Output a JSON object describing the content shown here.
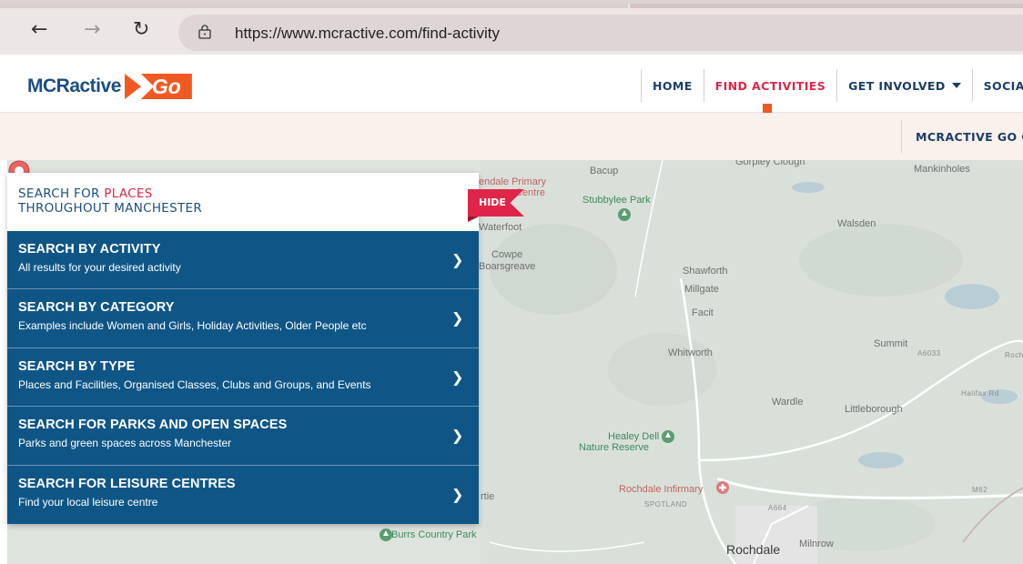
{
  "browser": {
    "back_icon": "back-arrow-icon",
    "forward_icon": "forward-arrow-icon",
    "reload_icon": "reload-icon",
    "url": "https://www.mcractive.com/find-activity"
  },
  "header": {
    "logo_text": "MCRactive",
    "logo_go": "Go",
    "nav": [
      {
        "label": "HOME",
        "active": false
      },
      {
        "label": "FIND ACTIVITIES",
        "active": true
      },
      {
        "label": "GET INVOLVED",
        "active": false,
        "dropdown": true
      },
      {
        "label": "SOCIAL",
        "active": false
      }
    ],
    "sub_nav_label": "MCRACTIVE GO C"
  },
  "panel": {
    "title_part1": "SEARCH FOR ",
    "title_highlight": "PLACES",
    "title_line2": "THROUGHOUT MANCHESTER",
    "hide_label": "HIDE",
    "rows": [
      {
        "title": "SEARCH BY ACTIVITY",
        "desc": "All results for your desired activity"
      },
      {
        "title": "SEARCH BY CATEGORY",
        "desc": "Examples include Women and Girls, Holiday Activities, Older People etc"
      },
      {
        "title": "SEARCH BY TYPE",
        "desc": "Places and Facilities, Organised Classes, Clubs and Groups, and Events"
      },
      {
        "title": "SEARCH FOR PARKS AND OPEN SPACES",
        "desc": "Parks and green spaces across Manchester"
      },
      {
        "title": "SEARCH FOR LEISURE CENTRES",
        "desc": "Find your local leisure centre"
      }
    ]
  },
  "map": {
    "labels": {
      "bacup": "Bacup",
      "stubbylee": "Stubbylee Park",
      "primary1": "endale Primary",
      "primary2": "Centre",
      "waterfoot": "Waterfoot",
      "cowpe": "Cowpe",
      "boarsgreave": "Boarsgreave",
      "mankinholes": "Mankinholes",
      "gorpley": "Gorpley Clough",
      "walsden": "Walsden",
      "shawforth": "Shawforth",
      "millgate": "Millgate",
      "facit": "Facit",
      "whitworth": "Whitworth",
      "summit": "Summit",
      "wardle": "Wardle",
      "littleborough": "Littleborough",
      "healey1": "Healey Dell",
      "healey2": "Nature Reserve",
      "infirmary": "Rochdale Infirmary",
      "spotland": "SPOTLAND",
      "rochdale": "Rochdale",
      "milnrow": "Milnrow",
      "burrs": "Burrs Country Park",
      "rtie": "rtie",
      "a6033": "A6033",
      "halifax": "Halifax Rd",
      "a664": "A664",
      "m62": "M62",
      "rochde": "Roche"
    },
    "pin_icon": "map-pin-icon",
    "park_icon": "park-icon",
    "hospital_icon": "hospital-icon"
  },
  "colors": {
    "brand_blue": "#1a4f80",
    "menu_blue": "#0f5687",
    "accent_red": "#e0254a",
    "accent_orange": "#f05a22"
  }
}
